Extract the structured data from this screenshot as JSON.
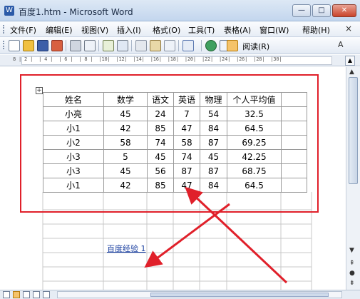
{
  "window": {
    "title": "百度1.htm - Microsoft Word",
    "app_icon": "W",
    "minimize_glyph": "—",
    "maximize_glyph": "□",
    "close_glyph": "✕"
  },
  "menu": {
    "items": [
      "文件(F)",
      "编辑(E)",
      "视图(V)",
      "插入(I)",
      "格式(O)",
      "工具(T)",
      "表格(A)",
      "窗口(W)",
      "帮助(H)"
    ],
    "close_glyph": "×"
  },
  "toolbar": {
    "read_label": "阅读(R)",
    "font_size_glyph": "A"
  },
  "ruler": {
    "text": "8 | 2 |  | 4 |  | 6 |  | 8 |  |10|  |12|  |14|  |16|  |18|  |20|  |22|  |24|  |26|  |28|  |30|"
  },
  "table": {
    "header": [
      "姓名",
      "数学",
      "语文",
      "英语",
      "物理",
      "个人平均值",
      ""
    ],
    "rows": [
      [
        "小亮",
        "45",
        "24",
        "7",
        "54",
        "32.5",
        ""
      ],
      [
        "小1",
        "42",
        "85",
        "47",
        "84",
        "64.5",
        ""
      ],
      [
        "小2",
        "58",
        "74",
        "58",
        "87",
        "69.25",
        ""
      ],
      [
        "小3",
        "5",
        "45",
        "74",
        "45",
        "42.25",
        ""
      ],
      [
        "小3",
        "45",
        "56",
        "87",
        "87",
        "68.75",
        ""
      ],
      [
        "小1",
        "42",
        "85",
        "47",
        "84",
        "64.5",
        ""
      ]
    ],
    "handle_glyph": "+"
  },
  "link": {
    "text": "百度经验 1"
  },
  "colors": {
    "annotation_red": "#e0202a",
    "link_blue": "#1a3fa0"
  }
}
